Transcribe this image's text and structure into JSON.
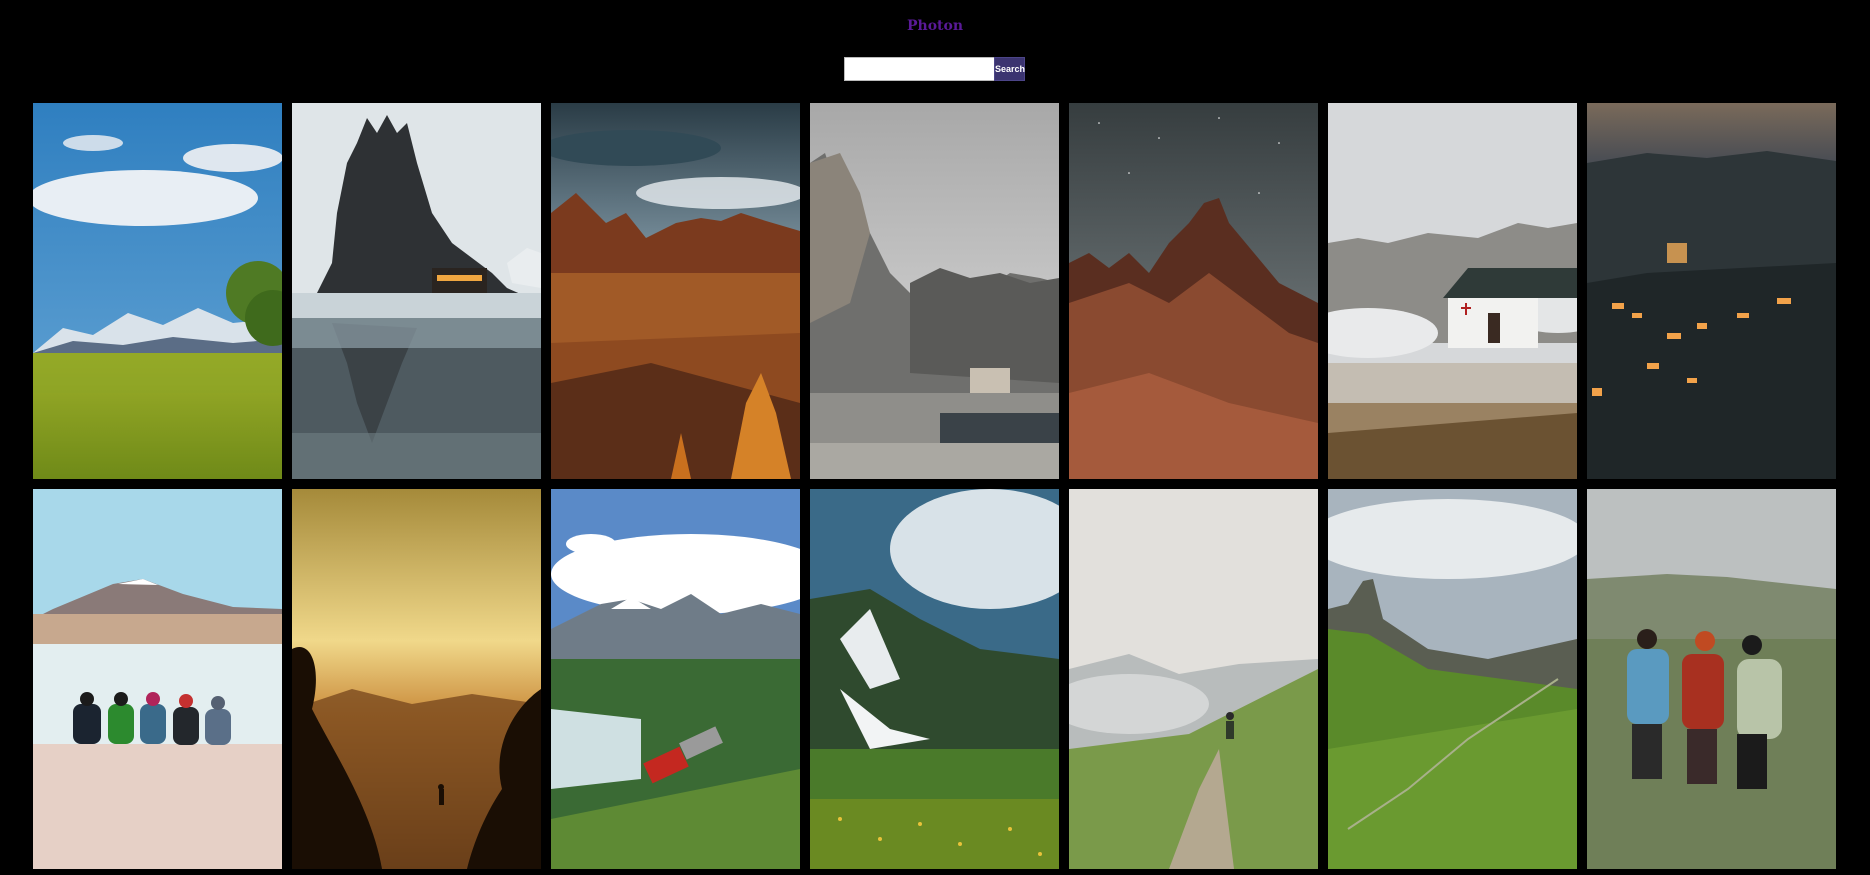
{
  "header": {
    "brand": "Photon"
  },
  "search": {
    "placeholder": "",
    "value": "",
    "button_label": "Search"
  },
  "gallery": {
    "photos": [
      {
        "subject": "grass-field-snow-mountains"
      },
      {
        "subject": "rock-spires-lodge-reflection"
      },
      {
        "subject": "autumn-dolomites-sky"
      },
      {
        "subject": "rock-tower-hut-lake"
      },
      {
        "subject": "red-peak-starry-sky"
      },
      {
        "subject": "white-chapel-clouds"
      },
      {
        "subject": "night-village-valley"
      },
      {
        "subject": "five-people-lakeshore-volcano"
      },
      {
        "subject": "golden-sunset-silhouette-hiker"
      },
      {
        "subject": "red-train-forest-mountains"
      },
      {
        "subject": "green-hills-snow-patches"
      },
      {
        "subject": "hiker-misty-trail"
      },
      {
        "subject": "green-ridge-rock-tower"
      },
      {
        "subject": "three-hikers-backpacks"
      }
    ]
  }
}
